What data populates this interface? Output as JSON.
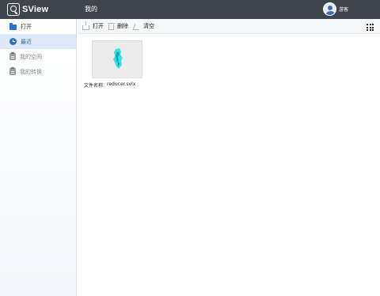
{
  "app": {
    "logo_text": "SView"
  },
  "header": {
    "title": "我的",
    "user_name": "游客"
  },
  "sidebar": {
    "items": [
      {
        "label": "打开",
        "icon": "folder-icon",
        "state": "normal"
      },
      {
        "label": "最近",
        "icon": "clock-icon",
        "state": "active"
      },
      {
        "label": "我的空间",
        "icon": "clipboard-icon",
        "state": "muted"
      },
      {
        "label": "我的转换",
        "icon": "clipboard-icon",
        "state": "muted"
      }
    ]
  },
  "toolbar": {
    "open_label": "打开",
    "delete_label": "删除",
    "clear_label": "清空",
    "view_icon": "grid-icon"
  },
  "files": [
    {
      "name_label": "文件名称:",
      "name": "reducer.svlx",
      "thumbnail_color": "#38e0e8"
    }
  ],
  "colors": {
    "topbar": "#3f444d",
    "accent": "#2f6fd0",
    "active_bg": "#dfeaf8"
  }
}
